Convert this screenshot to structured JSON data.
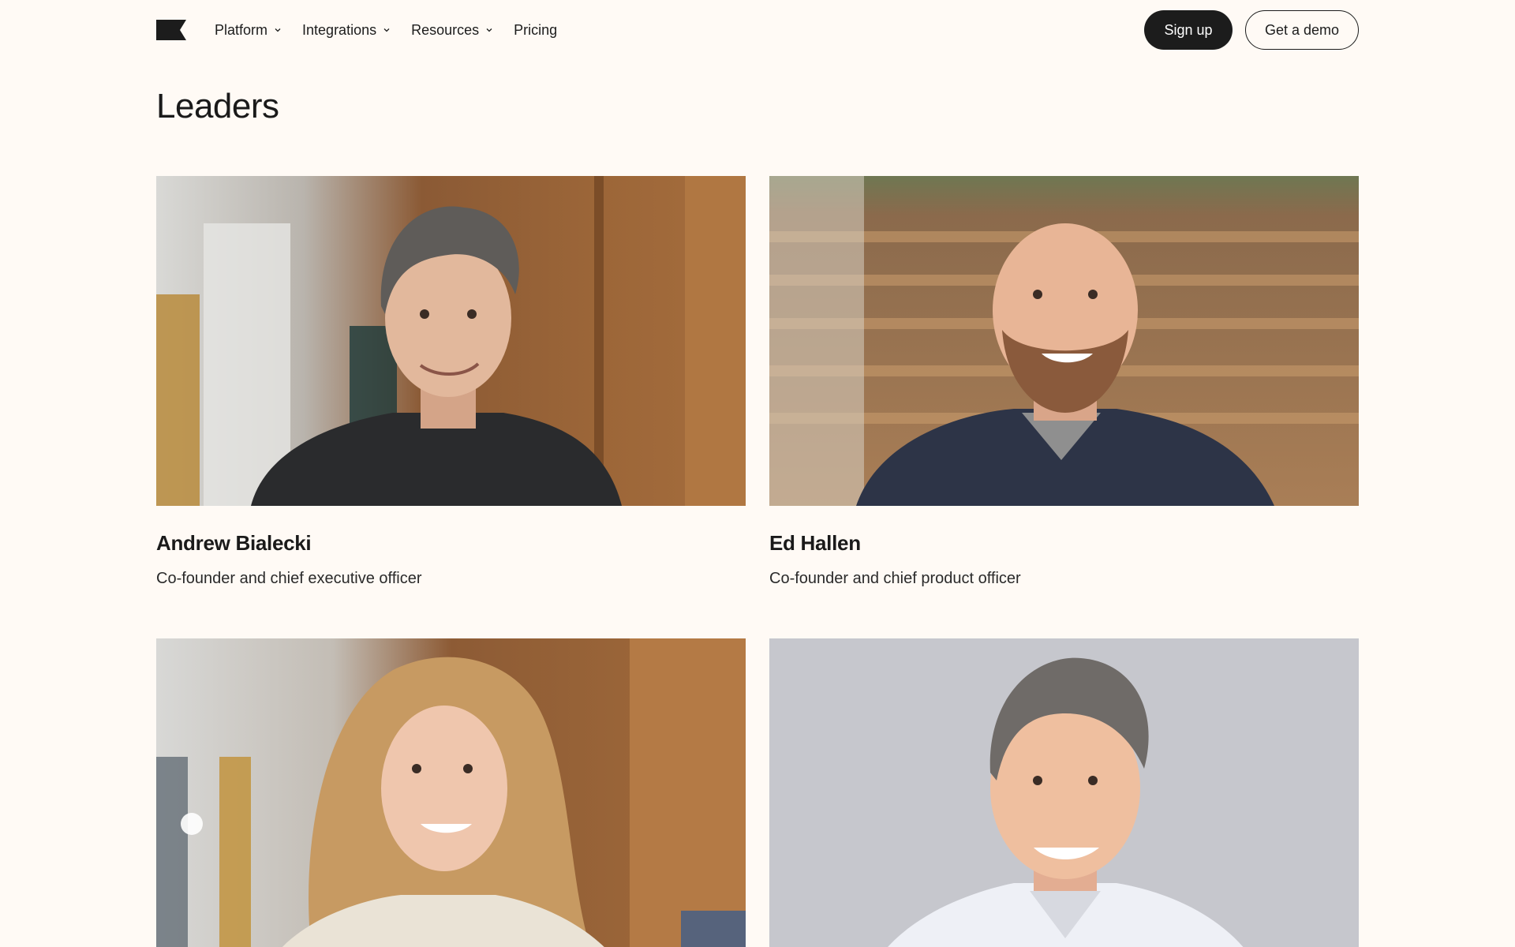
{
  "nav": {
    "items": [
      {
        "label": "Platform",
        "has_dropdown": true
      },
      {
        "label": "Integrations",
        "has_dropdown": true
      },
      {
        "label": "Resources",
        "has_dropdown": true
      },
      {
        "label": "Pricing",
        "has_dropdown": false
      }
    ],
    "signup_label": "Sign up",
    "demo_label": "Get a demo",
    "logo_icon": "flag-logo-icon"
  },
  "page": {
    "title": "Leaders"
  },
  "leaders": [
    {
      "name": "Andrew Bialecki",
      "role": "Co-founder and chief executive officer"
    },
    {
      "name": "Ed Hallen",
      "role": "Co-founder and chief product officer"
    },
    {
      "name": "",
      "role": ""
    },
    {
      "name": "",
      "role": ""
    }
  ],
  "colors": {
    "background": "#fffaf5",
    "text": "#1a1a1a",
    "button_dark": "#1c1c1c"
  }
}
